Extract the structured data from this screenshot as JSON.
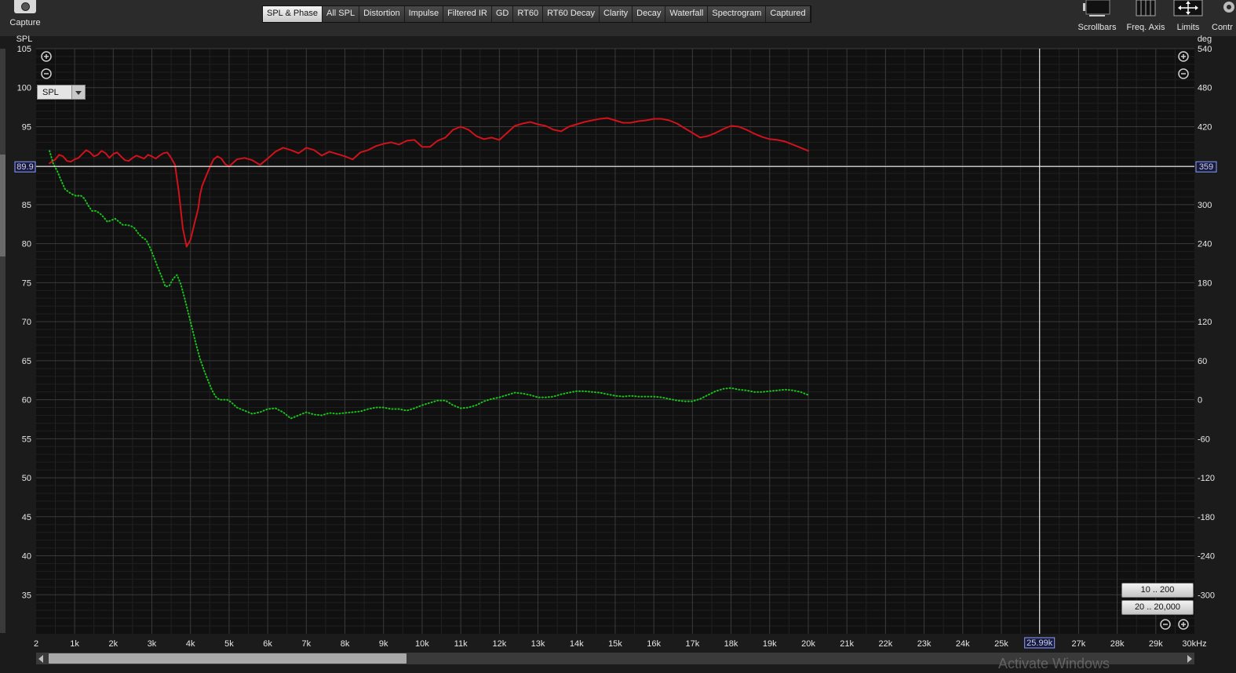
{
  "toolbar": {
    "capture_label": "Capture",
    "tabs": [
      {
        "label": "SPL & Phase",
        "active": true
      },
      {
        "label": "All SPL"
      },
      {
        "label": "Distortion"
      },
      {
        "label": "Impulse"
      },
      {
        "label": "Filtered IR"
      },
      {
        "label": "GD"
      },
      {
        "label": "RT60"
      },
      {
        "label": "RT60 Decay"
      },
      {
        "label": "Clarity"
      },
      {
        "label": "Decay"
      },
      {
        "label": "Waterfall"
      },
      {
        "label": "Spectrogram"
      },
      {
        "label": "Captured"
      }
    ],
    "tools": {
      "scrollbars": "Scrollbars",
      "freq_axis": "Freq. Axis",
      "limits": "Limits",
      "controls": "Contr"
    }
  },
  "panel": {
    "trace_selector": "SPL",
    "range_buttons": [
      "10 .. 200",
      "20 .. 20,000"
    ]
  },
  "watermark": "Activate Windows",
  "chart_data": {
    "type": "line",
    "xlabel": "",
    "ylabel": "SPL",
    "y2label": "deg",
    "x_unit": "kHz",
    "xlim": [
      2,
      30000
    ],
    "ylim": [
      30,
      105
    ],
    "y2lim": [
      -360,
      540
    ],
    "x_ticks": [
      [
        2,
        "2"
      ],
      [
        1000,
        "1k"
      ],
      [
        2000,
        "2k"
      ],
      [
        3000,
        "3k"
      ],
      [
        4000,
        "4k"
      ],
      [
        5000,
        "5k"
      ],
      [
        6000,
        "6k"
      ],
      [
        7000,
        "7k"
      ],
      [
        8000,
        "8k"
      ],
      [
        9000,
        "9k"
      ],
      [
        10000,
        "10k"
      ],
      [
        11000,
        "11k"
      ],
      [
        12000,
        "12k"
      ],
      [
        13000,
        "13k"
      ],
      [
        14000,
        "14k"
      ],
      [
        15000,
        "15k"
      ],
      [
        16000,
        "16k"
      ],
      [
        17000,
        "17k"
      ],
      [
        18000,
        "18k"
      ],
      [
        19000,
        "19k"
      ],
      [
        20000,
        "20k"
      ],
      [
        21000,
        "21k"
      ],
      [
        22000,
        "22k"
      ],
      [
        23000,
        "23k"
      ],
      [
        24000,
        "24k"
      ],
      [
        25000,
        "25k"
      ],
      [
        27000,
        "27k"
      ],
      [
        28000,
        "28k"
      ],
      [
        29000,
        "29k"
      ],
      [
        30000,
        "30kHz"
      ]
    ],
    "y_ticks": [
      35,
      40,
      45,
      50,
      55,
      60,
      65,
      70,
      75,
      80,
      85,
      90,
      95,
      100,
      105
    ],
    "y2_ticks": [
      -300,
      -240,
      -180,
      -120,
      -60,
      0,
      60,
      120,
      180,
      240,
      300,
      360,
      420,
      480,
      540
    ],
    "y2_hidden_tick": 360,
    "grid": true,
    "cursor": {
      "x_label": "25.99k",
      "x": 25990,
      "y": 89.9,
      "y_label": "89.9",
      "y2_label": "359"
    },
    "series": [
      {
        "color": "#d0121b",
        "style": "solid",
        "axis": "left",
        "x": [
          350,
          500,
          600,
          700,
          800,
          900,
          1000,
          1100,
          1200,
          1300,
          1400,
          1500,
          1600,
          1700,
          1800,
          1900,
          2000,
          2100,
          2200,
          2300,
          2400,
          2500,
          2600,
          2700,
          2800,
          2900,
          3000,
          3100,
          3200,
          3300,
          3400,
          3500,
          3600,
          3700,
          3800,
          3900,
          4000,
          4100,
          4200,
          4250,
          4300,
          4400,
          4500,
          4600,
          4700,
          4800,
          4900,
          5000,
          5200,
          5400,
          5600,
          5800,
          6000,
          6200,
          6400,
          6600,
          6800,
          7000,
          7200,
          7400,
          7600,
          7800,
          8000,
          8200,
          8400,
          8600,
          8800,
          9000,
          9200,
          9400,
          9600,
          9800,
          10000,
          10200,
          10400,
          10600,
          10800,
          11000,
          11200,
          11400,
          11600,
          11800,
          12000,
          12200,
          12400,
          12600,
          12800,
          13000,
          13200,
          13400,
          13600,
          13800,
          14000,
          14200,
          14400,
          14600,
          14800,
          15000,
          15200,
          15400,
          15600,
          15800,
          16000,
          16200,
          16400,
          16600,
          16800,
          17000,
          17200,
          17400,
          17600,
          17800,
          18000,
          18200,
          18400,
          18600,
          18800,
          19000,
          19200,
          19400,
          19600,
          19800,
          20000
        ],
        "y": [
          90.3,
          90.8,
          91.4,
          91.2,
          90.6,
          90.5,
          90.8,
          91.0,
          91.5,
          92.0,
          91.7,
          91.2,
          91.4,
          91.9,
          91.6,
          91.0,
          91.5,
          91.7,
          91.2,
          90.7,
          90.6,
          91.0,
          91.3,
          91.1,
          90.9,
          91.4,
          91.2,
          90.9,
          91.3,
          91.6,
          91.7,
          91.0,
          90.1,
          86.5,
          82.0,
          79.6,
          80.5,
          82.5,
          84.5,
          86.3,
          87.4,
          88.6,
          89.8,
          90.8,
          91.2,
          90.9,
          90.2,
          89.9,
          90.8,
          91.0,
          90.7,
          90.1,
          90.9,
          91.8,
          92.3,
          92.0,
          91.6,
          92.3,
          92.0,
          91.3,
          91.8,
          91.5,
          91.2,
          90.8,
          91.7,
          92.0,
          92.5,
          92.8,
          93.0,
          92.7,
          93.2,
          93.3,
          92.4,
          92.4,
          93.2,
          93.6,
          94.6,
          95.0,
          94.6,
          93.8,
          93.4,
          93.6,
          93.3,
          94.2,
          95.1,
          95.4,
          95.6,
          95.3,
          95.1,
          94.6,
          94.4,
          95.0,
          95.3,
          95.6,
          95.8,
          96.0,
          96.1,
          95.8,
          95.5,
          95.5,
          95.7,
          95.8,
          96.0,
          96.0,
          95.8,
          95.4,
          94.8,
          94.2,
          93.6,
          93.8,
          94.2,
          94.7,
          95.1,
          95.0,
          94.6,
          94.1,
          93.7,
          93.4,
          93.3,
          93.1,
          92.7,
          92.3,
          91.9
        ]
      },
      {
        "color": "#19c219",
        "style": "dotted",
        "axis": "left",
        "x": [
          350,
          450,
          550,
          650,
          750,
          850,
          950,
          1050,
          1150,
          1250,
          1350,
          1450,
          1550,
          1650,
          1750,
          1850,
          1950,
          2050,
          2150,
          2250,
          2350,
          2450,
          2550,
          2650,
          2750,
          2850,
          2950,
          3050,
          3150,
          3250,
          3350,
          3450,
          3550,
          3650,
          3750,
          3850,
          3950,
          4050,
          4150,
          4250,
          4350,
          4450,
          4550,
          4650,
          4750,
          4850,
          4950,
          5050,
          5200,
          5400,
          5600,
          5800,
          6000,
          6200,
          6400,
          6600,
          6800,
          7000,
          7200,
          7400,
          7600,
          7800,
          8000,
          8200,
          8400,
          8600,
          8800,
          9000,
          9200,
          9400,
          9600,
          9800,
          10000,
          10200,
          10400,
          10600,
          10800,
          11000,
          11200,
          11400,
          11600,
          11800,
          12000,
          12200,
          12400,
          12600,
          12800,
          13000,
          13200,
          13400,
          13600,
          13800,
          14000,
          14200,
          14400,
          14600,
          14800,
          15000,
          15200,
          15400,
          15600,
          15800,
          16000,
          16200,
          16400,
          16600,
          16800,
          17000,
          17200,
          17400,
          17600,
          17800,
          18000,
          18200,
          18400,
          18600,
          18800,
          19000,
          19200,
          19400,
          19600,
          19800,
          20000
        ],
        "y": [
          91.9,
          90.2,
          89.3,
          88.1,
          87.0,
          86.6,
          86.3,
          86.1,
          86.2,
          85.8,
          84.9,
          84.2,
          84.2,
          83.9,
          83.4,
          82.8,
          83.0,
          83.2,
          82.8,
          82.4,
          82.4,
          82.3,
          82.0,
          81.3,
          80.8,
          80.5,
          79.5,
          78.3,
          77.0,
          75.8,
          74.5,
          74.6,
          75.5,
          76.0,
          74.8,
          73.0,
          71.0,
          69.0,
          67.0,
          65.2,
          63.8,
          62.5,
          61.3,
          60.4,
          60.0,
          60.0,
          60.0,
          59.7,
          59.0,
          58.6,
          58.2,
          58.4,
          58.8,
          58.9,
          58.4,
          57.6,
          58.0,
          58.4,
          58.1,
          58.0,
          58.3,
          58.2,
          58.3,
          58.4,
          58.5,
          58.8,
          59.0,
          59.0,
          58.8,
          58.8,
          58.6,
          58.9,
          59.3,
          59.6,
          59.9,
          59.9,
          59.3,
          58.9,
          59.0,
          59.3,
          59.8,
          60.1,
          60.3,
          60.6,
          60.9,
          60.8,
          60.6,
          60.3,
          60.3,
          60.4,
          60.7,
          60.9,
          61.1,
          61.1,
          61.0,
          60.9,
          60.7,
          60.5,
          60.4,
          60.5,
          60.4,
          60.4,
          60.4,
          60.3,
          60.1,
          59.9,
          59.8,
          59.8,
          60.1,
          60.6,
          61.1,
          61.4,
          61.5,
          61.3,
          61.2,
          61.0,
          61.0,
          61.1,
          61.2,
          61.3,
          61.2,
          61.0,
          60.6
        ]
      }
    ]
  }
}
